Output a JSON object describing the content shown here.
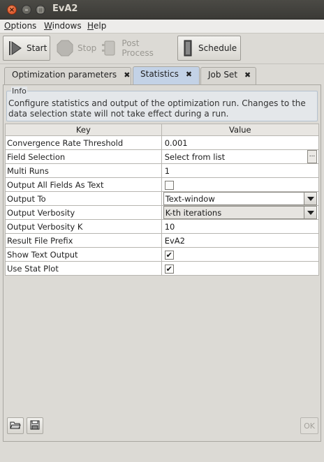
{
  "window": {
    "title": "EvA2"
  },
  "menu": [
    {
      "pre": "",
      "u": "O",
      "post": "ptions"
    },
    {
      "pre": "",
      "u": "W",
      "post": "indows"
    },
    {
      "pre": "",
      "u": "H",
      "post": "elp"
    }
  ],
  "toolbar": {
    "start_label": "Start",
    "stop_label": "Stop",
    "postprocess_label": "Post Process",
    "schedule_label": "Schedule"
  },
  "tabs": [
    {
      "label": "Optimization parameters"
    },
    {
      "label": "Statistics",
      "active": true
    },
    {
      "label": "Job Set"
    }
  ],
  "info": {
    "legend": "Info",
    "text": "Configure statistics and output of the optimization run. Changes to the data selection state will not take effect during a run."
  },
  "table": {
    "key_header": "Key",
    "value_header": "Value",
    "rows": [
      {
        "key": "Convergence Rate Threshold",
        "value": "0.001"
      },
      {
        "key": "Field Selection",
        "value": "Select from list",
        "ellipsis": "..."
      },
      {
        "key": "Multi Runs",
        "value": "1"
      },
      {
        "key": "Output All Fields As Text",
        "checked": false
      },
      {
        "key": "Output To",
        "value": "Text-window"
      },
      {
        "key": "Output Verbosity",
        "value": "K-th iterations"
      },
      {
        "key": "Output Verbosity K",
        "value": "10"
      },
      {
        "key": "Result File Prefix",
        "value": "EvA2"
      },
      {
        "key": "Show Text Output",
        "checked": true,
        "mark": "✔"
      },
      {
        "key": "Use Stat Plot",
        "checked": true,
        "mark": "✔"
      }
    ]
  },
  "bottom": {
    "ok_label": "OK"
  }
}
